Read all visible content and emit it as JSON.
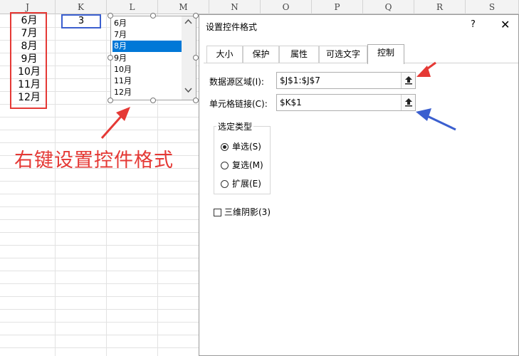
{
  "columns": [
    "J",
    "K",
    "L",
    "M",
    "N",
    "O",
    "P",
    "Q",
    "R",
    "S"
  ],
  "j_values": [
    "6月",
    "7月",
    "8月",
    "9月",
    "10月",
    "11月",
    "12月"
  ],
  "k1_value": "3",
  "listbox": {
    "items": [
      "6月",
      "7月",
      "8月",
      "9月",
      "10月",
      "11月",
      "12月"
    ],
    "selected": "8月"
  },
  "hint_text": "右键设置控件格式",
  "dialog": {
    "title": "设置控件格式",
    "help": "?",
    "close": "✕",
    "tabs": [
      "大小",
      "保护",
      "属性",
      "可选文字",
      "控制"
    ],
    "active_tab": "控制",
    "data_range_label": "数据源区域(I):",
    "data_range_value": "$J$1:$J$7",
    "cell_link_label": "单元格链接(C):",
    "cell_link_value": "$K$1",
    "selection_type_label": "选定类型",
    "selection_options": [
      "单选(S)",
      "复选(M)",
      "扩展(E)"
    ],
    "selected_option": "单选(S)",
    "shading_label": "三维阴影(3)"
  },
  "colors": {
    "red_annotation": "#e53935",
    "blue_annotation": "#3b5fcf",
    "selection": "#0078d7"
  },
  "icons": {
    "range_button": "collapse-up-arrow-icon",
    "scroll_up": "chevron-up-icon",
    "scroll_down": "chevron-down-icon"
  }
}
